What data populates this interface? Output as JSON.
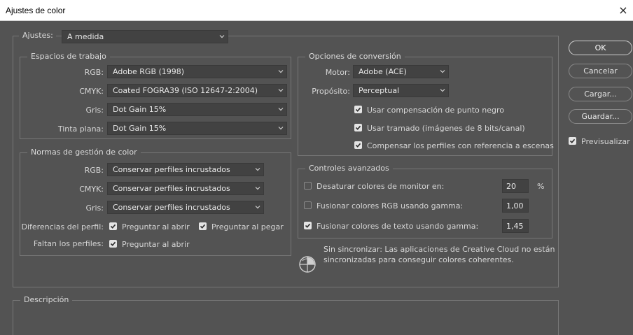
{
  "window": {
    "title": "Ajustes de color"
  },
  "ajustes": {
    "label": "Ajustes:",
    "value": "A medida"
  },
  "espacios": {
    "title": "Espacios de trabajo",
    "rgb": {
      "label": "RGB:",
      "value": "Adobe RGB (1998)"
    },
    "cmyk": {
      "label": "CMYK:",
      "value": "Coated FOGRA39 (ISO 12647-2:2004)"
    },
    "gris": {
      "label": "Gris:",
      "value": "Dot Gain 15%"
    },
    "tinta": {
      "label": "Tinta plana:",
      "value": "Dot Gain 15%"
    }
  },
  "normas": {
    "title": "Normas de gestión de color",
    "rgb": {
      "label": "RGB:",
      "value": "Conservar perfiles incrustados"
    },
    "cmyk": {
      "label": "CMYK:",
      "value": "Conservar perfiles incrustados"
    },
    "gris": {
      "label": "Gris:",
      "value": "Conservar perfiles incrustados"
    },
    "diferencias": {
      "label": "Diferencias del perfil:",
      "abrir": "Preguntar al abrir",
      "pegar": "Preguntar al pegar",
      "abrir_checked": true,
      "pegar_checked": true
    },
    "faltan": {
      "label": "Faltan los perfiles:",
      "abrir": "Preguntar al abrir",
      "abrir_checked": true
    }
  },
  "conversion": {
    "title": "Opciones de conversión",
    "motor": {
      "label": "Motor:",
      "value": "Adobe (ACE)"
    },
    "proposito": {
      "label": "Propósito:",
      "value": "Perceptual"
    },
    "punto_negro": {
      "label": "Usar compensación de punto negro",
      "checked": true
    },
    "tramado": {
      "label": "Usar tramado (imágenes de 8 bits/canal)",
      "checked": true
    },
    "escenas": {
      "label": "Compensar los perfiles con referencia a escenas",
      "checked": true
    }
  },
  "avanzados": {
    "title": "Controles avanzados",
    "desaturar": {
      "label": "Desaturar colores de monitor en:",
      "value": "20",
      "unit": "%",
      "checked": false
    },
    "fusionar_rgb": {
      "label": "Fusionar colores RGB usando gamma:",
      "value": "1,00",
      "checked": false
    },
    "fusionar_texto": {
      "label": "Fusionar colores de texto usando gamma:",
      "value": "1,45",
      "checked": true
    }
  },
  "sync": {
    "text_line1": "Sin sincronizar: Las aplicaciones de Creative Cloud no están",
    "text_line2": "sincronizadas para conseguir colores coherentes.",
    "icon": "creative-cloud-sync-icon"
  },
  "descripcion": {
    "title": "Descripción"
  },
  "buttons": {
    "ok": "OK",
    "cancelar": "Cancelar",
    "cargar": "Cargar...",
    "guardar": "Guardar..."
  },
  "preview": {
    "label": "Previsualizar",
    "checked": true
  }
}
